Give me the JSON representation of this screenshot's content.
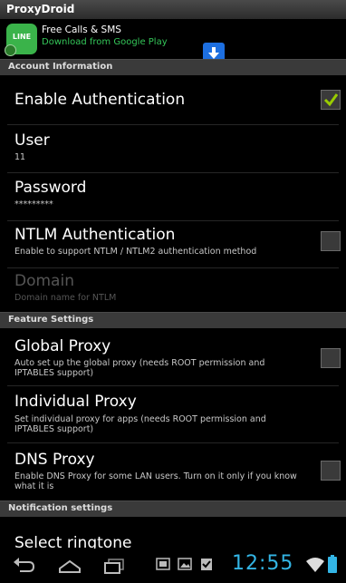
{
  "app": {
    "title": "ProxyDroid"
  },
  "ad": {
    "logo_text": "LINE",
    "title": "Free Calls & SMS",
    "subtitle": "Download from Google Play"
  },
  "sections": {
    "account": "Account Information",
    "feature": "Feature Settings",
    "notification": "Notification settings"
  },
  "prefs": {
    "enable_auth": {
      "title": "Enable Authentication",
      "checked": true
    },
    "user": {
      "title": "User",
      "value": "11"
    },
    "password": {
      "title": "Password",
      "value": "*********"
    },
    "ntlm": {
      "title": "NTLM Authentication",
      "summary": "Enable to support NTLM / NTLM2 authentication method",
      "checked": false
    },
    "domain": {
      "title": "Domain",
      "summary": "Domain name for NTLM"
    },
    "global_proxy": {
      "title": "Global Proxy",
      "summary": "Auto set up the global proxy (needs ROOT permission and IPTABLES support)",
      "checked": false
    },
    "individual_proxy": {
      "title": "Individual Proxy",
      "summary": "Set individual proxy for apps (needs ROOT permission and IPTABLES support)"
    },
    "dns_proxy": {
      "title": "DNS Proxy",
      "summary": "Enable DNS Proxy for some LAN users. Turn on it only if you know what it is",
      "checked": false
    },
    "ringtone": {
      "title": "Select ringtone"
    }
  },
  "statusbar": {
    "time": "12:55"
  },
  "colors": {
    "accent": "#33b5e5",
    "check": "#99cc00",
    "ad_green": "#34c759"
  },
  "icons": [
    "back-icon",
    "home-icon",
    "recents-icon",
    "gallery-icon",
    "image-icon",
    "clipboard-check-icon",
    "wifi-icon",
    "battery-icon",
    "download-arrow-icon",
    "checkmark-icon"
  ]
}
